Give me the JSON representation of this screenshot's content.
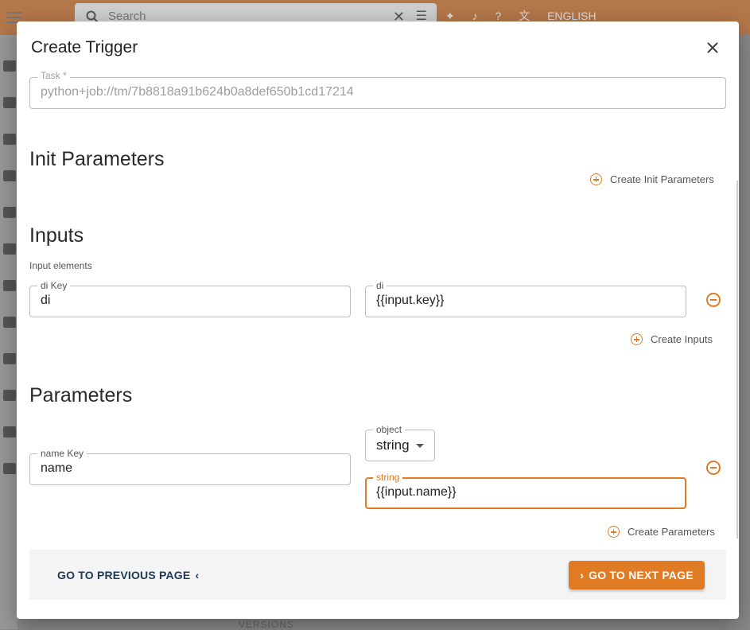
{
  "background": {
    "search_placeholder": "Search",
    "language": "ENGLISH",
    "bottom_tab": "VERSIONS"
  },
  "dialog": {
    "title": "Create Trigger",
    "task": {
      "label": "Task *",
      "value": "python+job://tm/7b8818a91b624b0a8def650b1cd17214"
    },
    "init_parameters": {
      "title": "Init Parameters",
      "create_label": "Create Init Parameters"
    },
    "inputs": {
      "title": "Inputs",
      "subtitle": "Input elements",
      "rows": [
        {
          "key_label": "di Key",
          "key_value": "di",
          "value_label": "di",
          "value": "{{input.key}}"
        }
      ],
      "create_label": "Create Inputs"
    },
    "parameters": {
      "title": "Parameters",
      "rows": [
        {
          "key_label": "name Key",
          "key_value": "name",
          "type_label": "object",
          "type_value": "string",
          "value_label": "string",
          "value": "{{input.name}}"
        }
      ],
      "create_label": "Create Parameters"
    },
    "footer": {
      "prev_label": "GO TO PREVIOUS PAGE",
      "next_label": "GO TO NEXT PAGE"
    }
  },
  "colors": {
    "accent": "#e07b24",
    "prev_text": "#1c3a57"
  },
  "icons": {
    "close": "close-icon",
    "add": "add-circle-icon",
    "remove": "remove-circle-icon",
    "prev": "chevron-left-icon",
    "next": "chevron-right-icon",
    "dropdown": "caret-down-icon"
  }
}
